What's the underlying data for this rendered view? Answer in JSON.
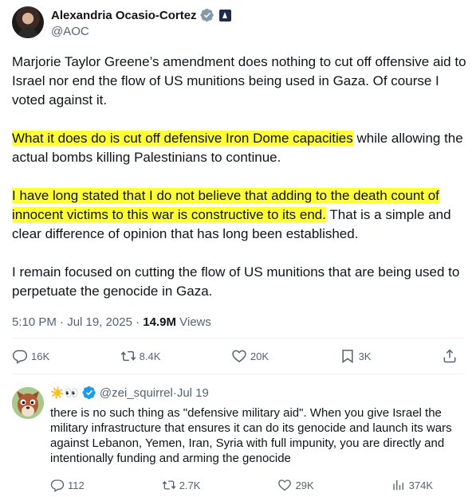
{
  "post": {
    "author": {
      "name": "Alexandria Ocasio-Cortez",
      "handle": "@AOC"
    },
    "paragraphs": [
      {
        "highlight": "",
        "text": "Marjorie Taylor Greene’s amendment does nothing to cut off offensive aid to Israel nor end the flow of US munitions being used in Gaza. Of course I voted against it."
      },
      {
        "highlight": "What it does do is cut off defensive Iron Dome capacities",
        "text": " while allowing the actual bombs killing Palestinians to continue."
      },
      {
        "highlight": "I have long stated that I do not believe that adding to the death count of innocent victims to this war is constructive to its end.",
        "text": " That is a simple and clear difference of opinion that has long been established."
      },
      {
        "highlight": "",
        "text": "I remain focused on cutting the flow of US munitions that are being used to perpetuate the genocide in Gaza."
      }
    ],
    "timestamp": "5:10 PM · Jul 19, 2025 · ",
    "views_count": "14.9M",
    "views_label": " Views",
    "actions": {
      "replies": "16K",
      "reposts": "8.4K",
      "likes": "20K",
      "bookmarks": "3K"
    },
    "highlight_color": "#ffff36"
  },
  "reply": {
    "emoji": "☀️👀",
    "handle": "@zei_squirrel",
    "separator": " · ",
    "date": "Jul 19",
    "text": "there is no such thing as \"defensive military aid\". When you give Israel the military infrastructure that ensures it can do its genocide and launch its wars against Lebanon, Yemen, Iran, Syria with full impunity, you are directly and intentionally funding and arming the genocide",
    "actions": {
      "replies": "112",
      "reposts": "2.7K",
      "likes": "29K",
      "views": "374K"
    }
  },
  "colors": {
    "verified": "#1d9bf0",
    "muted": "#536471",
    "text": "#0f1419"
  }
}
